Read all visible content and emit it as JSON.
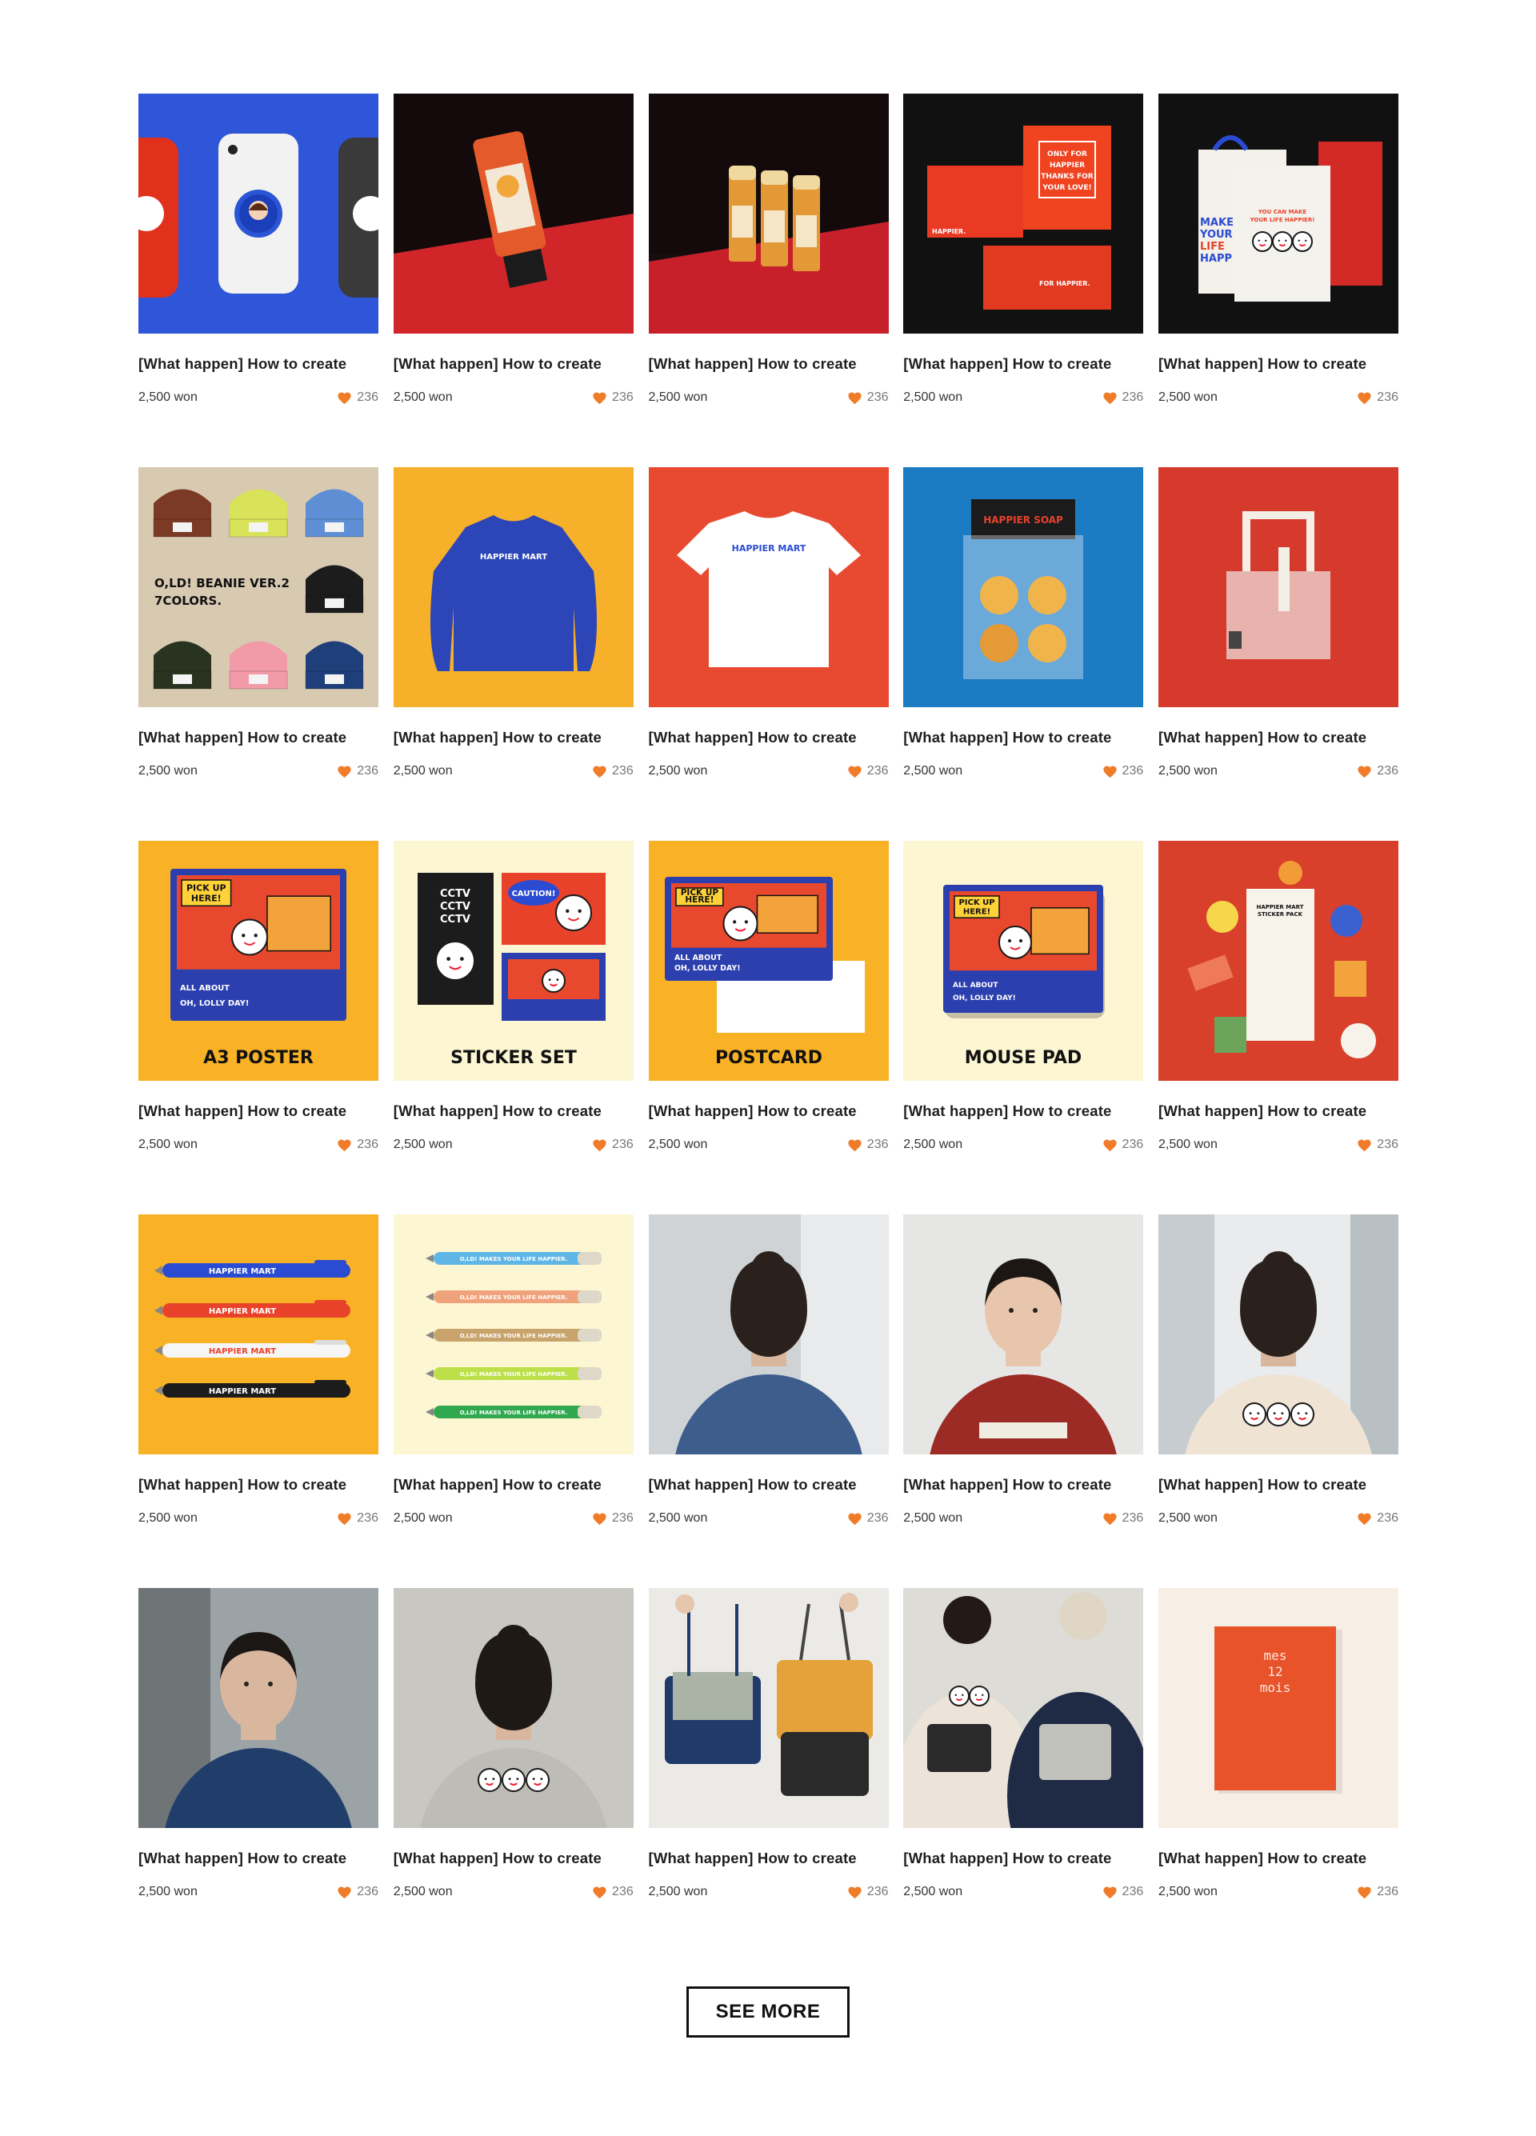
{
  "accent": "#f07c2a",
  "products": [
    {
      "title": "[What happen] How to create",
      "price": "2,500 won",
      "likes": "236",
      "image": "phone-grip",
      "bg": "#2f55d8"
    },
    {
      "title": "[What happen] How to create",
      "price": "2,500 won",
      "likes": "236",
      "image": "hand-cream",
      "bg": "#1a0d0e"
    },
    {
      "title": "[What happen] How to create",
      "price": "2,500 won",
      "likes": "236",
      "image": "lip-balm",
      "bg": "#1a0d0e"
    },
    {
      "title": "[What happen] How to create",
      "price": "2,500 won",
      "likes": "236",
      "image": "gift-boxes",
      "bg": "#111111",
      "texts": [
        "ONLY FOR",
        "HAPPIER",
        "THANKS FOR",
        "YOUR LOVE!",
        "HAPPIER.",
        "FOR HAPPIER."
      ]
    },
    {
      "title": "[What happen] How to create",
      "price": "2,500 won",
      "likes": "236",
      "image": "paper-bags",
      "bg": "#111111",
      "texts": [
        "MAKE",
        "YOUR",
        "LIFE",
        "HAPP",
        "YOU CAN MAKE",
        "YOUR LIFE HAPPIER!"
      ]
    },
    {
      "title": "[What happen] How to create",
      "price": "2,500 won",
      "likes": "236",
      "image": "beanies",
      "bg": "#d8c9b1",
      "texts": [
        "O,LD! BEANIE VER.2",
        "7COLORS."
      ]
    },
    {
      "title": "[What happen] How to create",
      "price": "2,500 won",
      "likes": "236",
      "image": "sweatshirt",
      "bg": "#f7b02a",
      "texts": [
        "HAPPIER MART"
      ]
    },
    {
      "title": "[What happen] How to create",
      "price": "2,500 won",
      "likes": "236",
      "image": "tshirt",
      "bg": "#e84a31",
      "texts": [
        "HAPPIER MART"
      ]
    },
    {
      "title": "[What happen] How to create",
      "price": "2,500 won",
      "likes": "236",
      "image": "soap",
      "bg": "#1b7cc4",
      "texts": [
        "HAPPIER SOAP"
      ]
    },
    {
      "title": "[What happen] How to create",
      "price": "2,500 won",
      "likes": "236",
      "image": "tote",
      "bg": "#d63a2c"
    },
    {
      "title": "[What happen] How to create",
      "price": "2,500 won",
      "likes": "236",
      "image": "a3-poster",
      "bg": "#f9b226",
      "texts": [
        "A3 POSTER",
        "PICK UP",
        "HERE!",
        "ALL ABOUT",
        "OH, LOLLY DAY!"
      ]
    },
    {
      "title": "[What happen] How to create",
      "price": "2,500 won",
      "likes": "236",
      "image": "sticker-set",
      "bg": "#fdf6d3",
      "texts": [
        "STICKER SET",
        "CCTV",
        "CCTV",
        "CCTV",
        "CAUTION!"
      ]
    },
    {
      "title": "[What happen] How to create",
      "price": "2,500 won",
      "likes": "236",
      "image": "postcard",
      "bg": "#f9b226",
      "texts": [
        "POSTCARD",
        "PICK UP",
        "HERE!",
        "ALL ABOUT",
        "OH, LOLLY DAY!"
      ]
    },
    {
      "title": "[What happen] How to create",
      "price": "2,500 won",
      "likes": "236",
      "image": "mouse-pad",
      "bg": "#fdf6d3",
      "texts": [
        "MOUSE PAD",
        "PICK UP",
        "HERE!",
        "ALL ABOUT",
        "OH, LOLLY DAY!"
      ]
    },
    {
      "title": "[What happen] How to create",
      "price": "2,500 won",
      "likes": "236",
      "image": "stickers",
      "bg": "#d8402c",
      "texts": [
        "HAPPIER MART",
        "STICKER PACK"
      ]
    },
    {
      "title": "[What happen] How to create",
      "price": "2,500 won",
      "likes": "236",
      "image": "pens",
      "bg": "#f9b226",
      "texts": [
        "HAPPIER MART",
        "HAPPIER MART",
        "HAPPIER MART",
        "HAPPIER MART"
      ]
    },
    {
      "title": "[What happen] How to create",
      "price": "2,500 won",
      "likes": "236",
      "image": "pens-pastel",
      "bg": "#fdf6d3",
      "texts": [
        "O,LD! MAKES YOUR LIFE HAPPIER."
      ]
    },
    {
      "title": "[What happen] How to create",
      "price": "2,500 won",
      "likes": "236",
      "image": "photo-blue-sweater",
      "bg": "#cfd3d6"
    },
    {
      "title": "[What happen] How to create",
      "price": "2,500 won",
      "likes": "236",
      "image": "photo-red-sweater",
      "bg": "#e6e6e4"
    },
    {
      "title": "[What happen] How to create",
      "price": "2,500 won",
      "likes": "236",
      "image": "photo-beige-sweater",
      "bg": "#e9ebec"
    },
    {
      "title": "[What happen] How to create",
      "price": "2,500 won",
      "likes": "236",
      "image": "photo-navy-sweater",
      "bg": "#9ca3a6"
    },
    {
      "title": "[What happen] How to create",
      "price": "2,500 won",
      "likes": "236",
      "image": "photo-gray-sweater",
      "bg": "#c9c7c2"
    },
    {
      "title": "[What happen] How to create",
      "price": "2,500 won",
      "likes": "236",
      "image": "photo-bags",
      "bg": "#eceae6"
    },
    {
      "title": "[What happen] How to create",
      "price": "2,500 won",
      "likes": "236",
      "image": "photo-couple-bags",
      "bg": "#dedcd7"
    },
    {
      "title": "[What happen] How to create",
      "price": "2,500 won",
      "likes": "236",
      "image": "notebook",
      "bg": "#f7efe6",
      "texts": [
        "mes",
        "12",
        "mois"
      ]
    }
  ],
  "see_more_label": "SEE MORE"
}
